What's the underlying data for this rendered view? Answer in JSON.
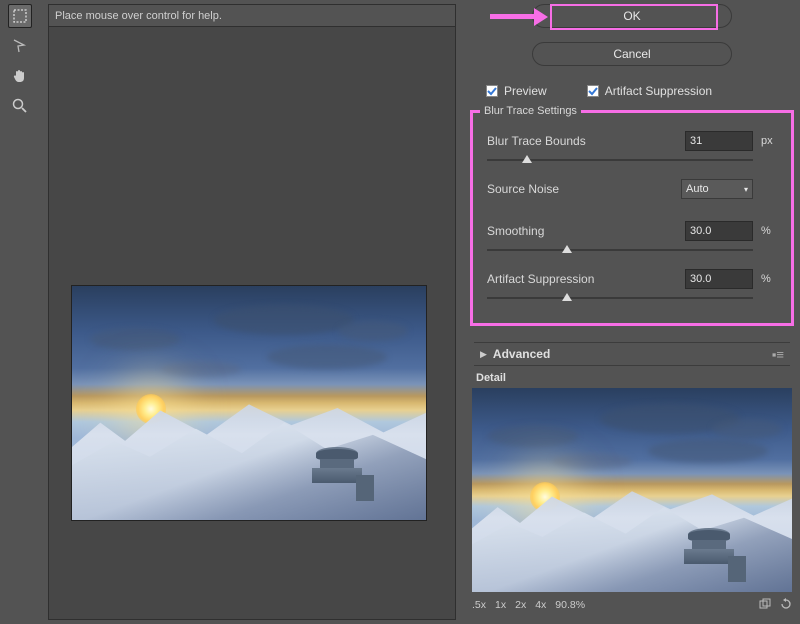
{
  "help_text": "Place mouse over control for help.",
  "buttons": {
    "ok": "OK",
    "cancel": "Cancel"
  },
  "checkboxes": {
    "preview": "Preview",
    "artifact": "Artifact Suppression"
  },
  "blur_trace": {
    "title": "Blur Trace Settings",
    "bounds_label": "Blur Trace Bounds",
    "bounds_value": "31",
    "bounds_unit": "px",
    "noise_label": "Source Noise",
    "noise_value": "Auto",
    "smoothing_label": "Smoothing",
    "smoothing_value": "30.0",
    "smoothing_unit": "%",
    "artifact_label": "Artifact Suppression",
    "artifact_value": "30.0",
    "artifact_unit": "%"
  },
  "advanced_label": "Advanced",
  "detail_label": "Detail",
  "zoom": {
    "z05": ".5x",
    "z1": "1x",
    "z2": "2x",
    "z4": "4x",
    "pct": "90.8%"
  }
}
